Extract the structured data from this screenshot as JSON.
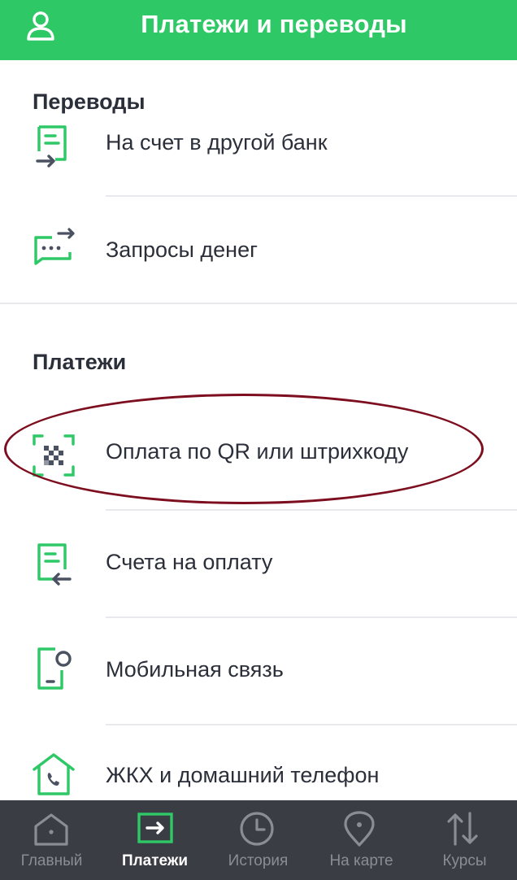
{
  "header": {
    "title": "Платежи и переводы",
    "profile_icon": "user-icon",
    "background": "#2ec866"
  },
  "transfers": {
    "title": "Переводы",
    "items": [
      {
        "label": "На счет в другой банк",
        "icon": "document-transfer-icon"
      },
      {
        "label": "Запросы денег",
        "icon": "message-request-icon"
      }
    ]
  },
  "payments": {
    "title": "Платежи",
    "items": [
      {
        "label": "Оплата по QR или штрихкоду",
        "icon": "qr-scan-icon"
      },
      {
        "label": "Счета на оплату",
        "icon": "invoice-icon"
      },
      {
        "label": "Мобильная связь",
        "icon": "mobile-phone-icon"
      },
      {
        "label": "ЖКХ и домашний телефон",
        "icon": "house-phone-icon"
      }
    ]
  },
  "tabbar": {
    "active": "Платежи",
    "items": [
      {
        "label": "Главный",
        "icon": "home-icon"
      },
      {
        "label": "Платежи",
        "icon": "payments-arrow-icon"
      },
      {
        "label": "История",
        "icon": "clock-icon"
      },
      {
        "label": "На карте",
        "icon": "map-pin-icon"
      },
      {
        "label": "Курсы",
        "icon": "exchange-arrows-icon"
      }
    ]
  },
  "colors": {
    "accent": "#2ec866",
    "icon_dark": "#4a5160",
    "highlight": "#7d0e1f",
    "tabbar": "#3a3d44"
  }
}
